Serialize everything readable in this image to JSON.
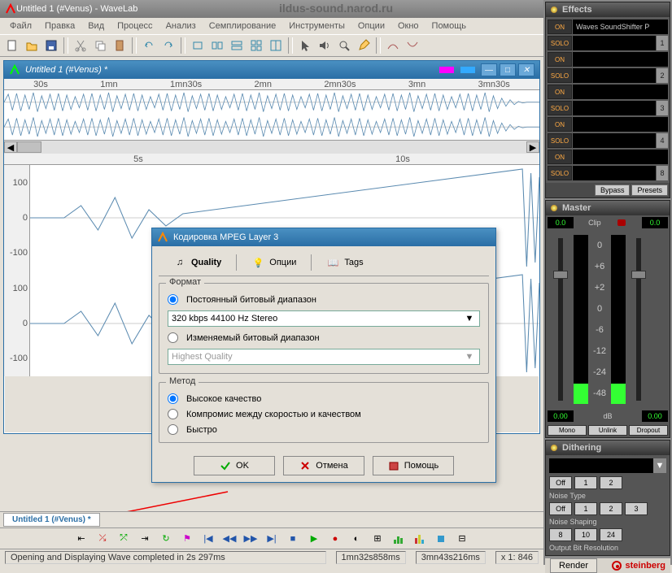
{
  "app": {
    "title": "Untitled 1 (#Venus) - WaveLab",
    "watermark": "ildus-sound.narod.ru"
  },
  "menu": [
    "Файл",
    "Правка",
    "Вид",
    "Процесс",
    "Анализ",
    "Семплирование",
    "Инструменты",
    "Опции",
    "Окно",
    "Помощь"
  ],
  "wavewin": {
    "title": "Untitled 1 (#Venus) *",
    "timeline": [
      "",
      "30s",
      "1mn",
      "1mn30s",
      "2mn",
      "2mn30s",
      "3mn",
      "3mn30s"
    ],
    "timeline2": [
      "",
      "5s",
      "10s"
    ],
    "amp": [
      "100",
      "0",
      "-100",
      "100",
      "0",
      "-100"
    ]
  },
  "dialog": {
    "title": "Кодировка MPEG Layer 3",
    "tabs": {
      "quality": "Quality",
      "options": "Опции",
      "tags": "Tags"
    },
    "fmt": {
      "legend": "Формат",
      "cbr": "Постоянный битовый диапазон",
      "bitrate": "320 kbps  44100 Hz  Stereo",
      "vbr": "Изменяемый битовый диапазон",
      "vbr_quality": "Highest Quality"
    },
    "method": {
      "legend": "Метод",
      "hq": "Высокое качество",
      "mid": "Компромис между скоростью и качеством",
      "fast": "Быстро"
    },
    "buttons": {
      "ok": "OK",
      "cancel": "Отмена",
      "help": "Помощь"
    }
  },
  "doctab": "Untitled 1 (#Venus) *",
  "status": {
    "msg": "Opening and Displaying Wave completed in 2s 297ms",
    "t1": "1mn32s858ms",
    "t2": "3mn43s216ms",
    "zoom": "x 1: 846"
  },
  "effects": {
    "title": "Effects",
    "on": "ON",
    "solo": "SOLO",
    "slot1": "Waves SoundShifter P",
    "bypass": "Bypass",
    "presets": "Presets"
  },
  "master": {
    "title": "Master",
    "val": "0.0",
    "clip": "Clip",
    "scale": [
      "0",
      "+6",
      "+2",
      "0",
      "-6",
      "-12",
      "-24",
      "-48"
    ],
    "bottom": {
      "val": "0.00",
      "db": "dB",
      "mono": "Mono",
      "unlink": "Unlink",
      "dropout": "Dropout"
    }
  },
  "dither": {
    "title": "Dithering",
    "off": "Off",
    "noise_type": "Noise Type",
    "noise_shaping": "Noise Shaping",
    "obr": "Output Bit Resolution",
    "vals1": [
      "1",
      "2"
    ],
    "vals2": [
      "1",
      "2",
      "3"
    ],
    "vals3": [
      "8",
      "10",
      "24"
    ]
  },
  "footer": {
    "render": "Render",
    "brand": "steinberg"
  }
}
